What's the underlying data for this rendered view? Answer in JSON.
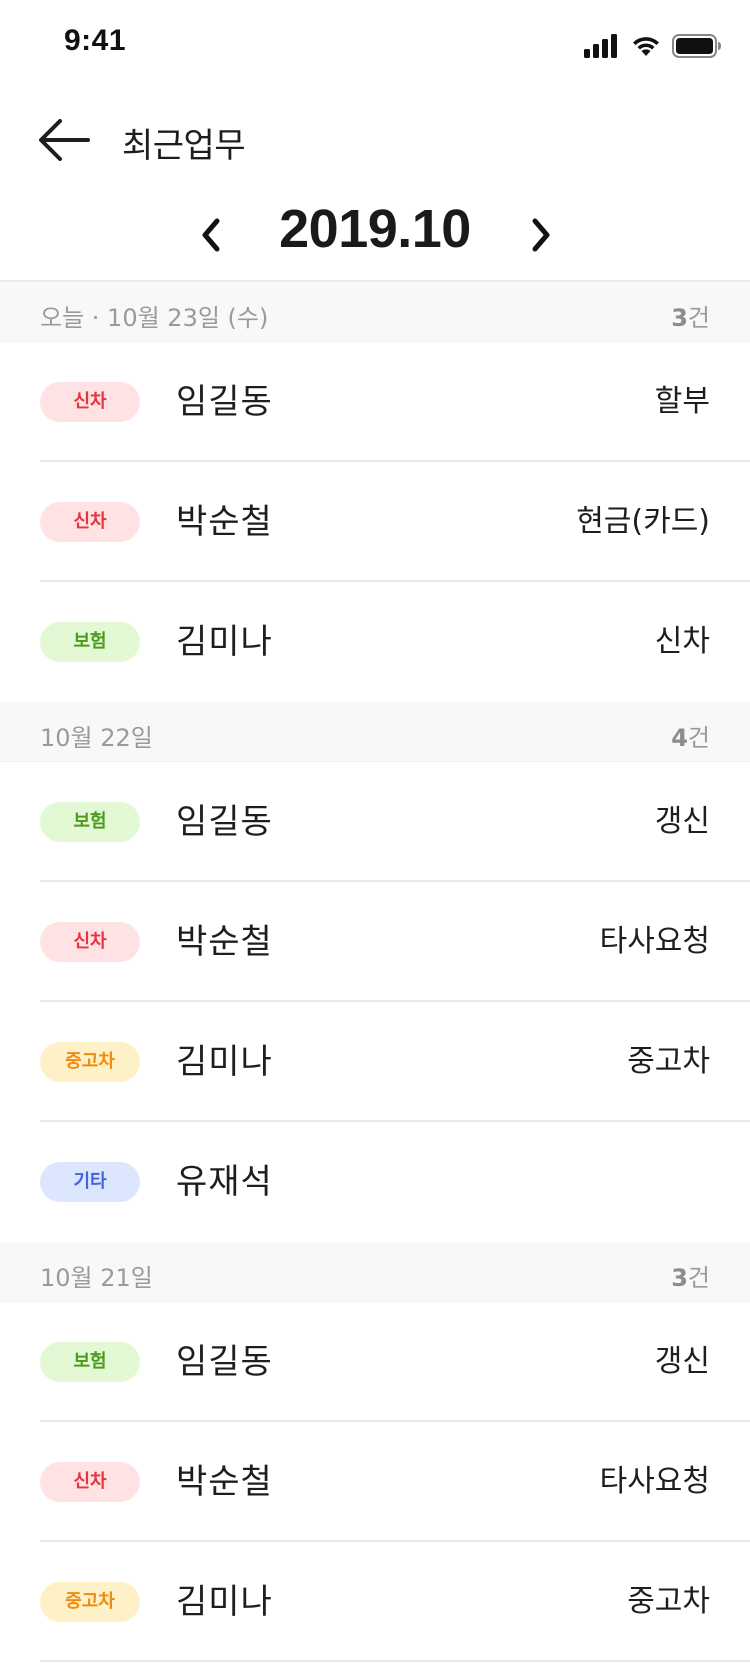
{
  "status_bar": {
    "time": "9:41"
  },
  "header": {
    "title": "최근업무"
  },
  "month_selector": {
    "label": "2019.10"
  },
  "sections": [
    {
      "date": "오늘 · 10월 23일 (수)",
      "count": "3",
      "count_unit": "건",
      "items": [
        {
          "tag": "신차",
          "tag_type": "new",
          "name": "임길동",
          "detail": "할부"
        },
        {
          "tag": "신차",
          "tag_type": "new",
          "name": "박순철",
          "detail": "현금(카드)"
        },
        {
          "tag": "보험",
          "tag_type": "ins",
          "name": "김미나",
          "detail": "신차"
        }
      ]
    },
    {
      "date": "10월 22일",
      "count": "4",
      "count_unit": "건",
      "items": [
        {
          "tag": "보험",
          "tag_type": "ins",
          "name": "임길동",
          "detail": "갱신"
        },
        {
          "tag": "신차",
          "tag_type": "new",
          "name": "박순철",
          "detail": "타사요청"
        },
        {
          "tag": "중고차",
          "tag_type": "used",
          "name": "김미나",
          "detail": "중고차"
        },
        {
          "tag": "기타",
          "tag_type": "etc",
          "name": "유재석",
          "detail": ""
        }
      ]
    },
    {
      "date": "10월 21일",
      "count": "3",
      "count_unit": "건",
      "items": [
        {
          "tag": "보험",
          "tag_type": "ins",
          "name": "임길동",
          "detail": "갱신"
        },
        {
          "tag": "신차",
          "tag_type": "new",
          "name": "박순철",
          "detail": "타사요청"
        },
        {
          "tag": "중고차",
          "tag_type": "used",
          "name": "김미나",
          "detail": "중고차"
        }
      ]
    }
  ],
  "icons": {
    "status": [
      "cellular-signal-icon",
      "wifi-icon",
      "battery-icon"
    ],
    "navigation": [
      "back-arrow-icon",
      "chevron-left-icon",
      "chevron-right-icon"
    ]
  },
  "colors": {
    "tag_new_bg": "#ffe2e4",
    "tag_new_text": "#e4353f",
    "tag_ins_bg": "#e3f8d4",
    "tag_ins_text": "#4d9a1e",
    "tag_used_bg": "#fff1c7",
    "tag_used_text": "#ef8c10",
    "tag_etc_bg": "#dde6ff",
    "tag_etc_text": "#4464dd",
    "section_bg": "#f8f8f8"
  }
}
